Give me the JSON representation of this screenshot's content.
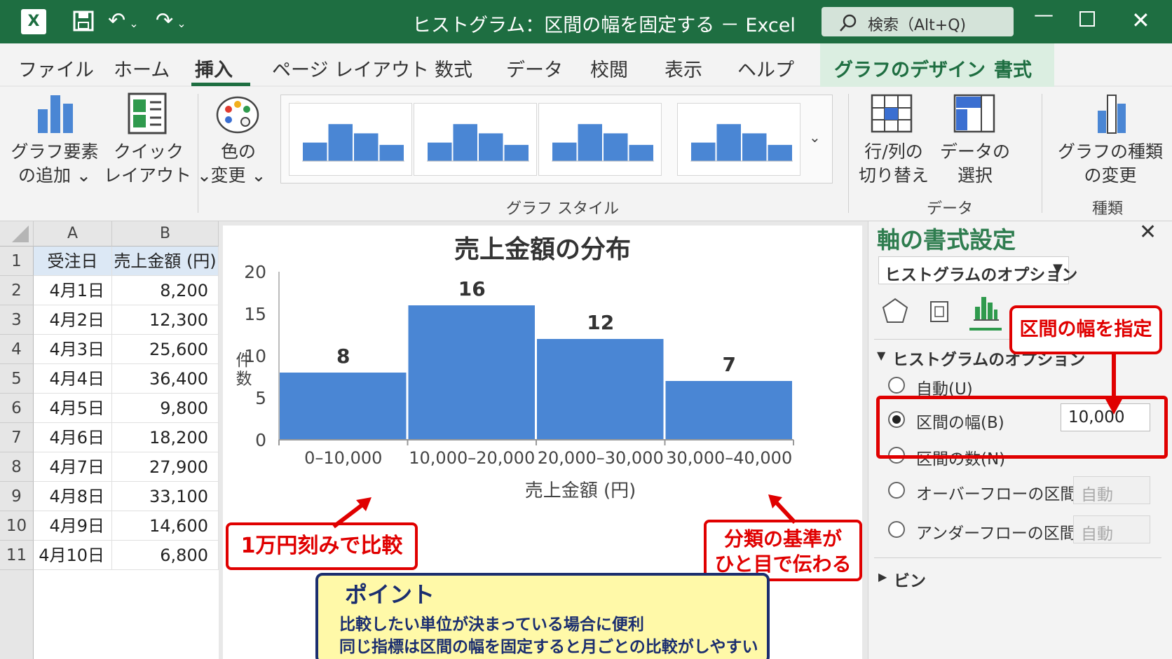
{
  "titlebar": {
    "title": "ヒストグラム：区間の幅を固定する － Excel",
    "search_placeholder": "検索（Alt+Q)"
  },
  "tabs": [
    "ファイル",
    "ホーム",
    "挿入",
    "ページ レイアウト",
    "数式",
    "データ",
    "校閲",
    "表示",
    "ヘルプ"
  ],
  "context_tabs": [
    "グラフのデザイン",
    "書式"
  ],
  "ribbon": {
    "add_element": [
      "グラフ要素",
      "の追加 ⌄"
    ],
    "quick_layout": [
      "クイック",
      "レイアウト ⌄"
    ],
    "colors": [
      "色の",
      "変更 ⌄"
    ],
    "styles_group": "グラフ スタイル",
    "switch_rowcol": [
      "行/列の",
      "切り替え"
    ],
    "select_data": [
      "データの",
      "選択"
    ],
    "data_group": "データ",
    "change_type": [
      "グラフの種類",
      "の変更"
    ],
    "type_group": "種類"
  },
  "sheet": {
    "columns": [
      "A",
      "B"
    ],
    "header": {
      "row": "1",
      "a": "受注日",
      "b": "売上金額 (円)"
    },
    "rows": [
      {
        "n": "2",
        "date": "4月1日",
        "amount": "8,200"
      },
      {
        "n": "3",
        "date": "4月2日",
        "amount": "12,300"
      },
      {
        "n": "4",
        "date": "4月3日",
        "amount": "25,600"
      },
      {
        "n": "5",
        "date": "4月4日",
        "amount": "36,400"
      },
      {
        "n": "6",
        "date": "4月5日",
        "amount": "9,800"
      },
      {
        "n": "7",
        "date": "4月6日",
        "amount": "18,200"
      },
      {
        "n": "8",
        "date": "4月7日",
        "amount": "27,900"
      },
      {
        "n": "9",
        "date": "4月8日",
        "amount": "33,100"
      },
      {
        "n": "10",
        "date": "4月9日",
        "amount": "14,600"
      },
      {
        "n": "11",
        "date": "4月10日",
        "amount": "6,800"
      }
    ]
  },
  "chart_data": {
    "type": "bar",
    "title": "売上金額の分布",
    "xlabel": "売上金額 (円)",
    "ylabel": "件数",
    "categories": [
      "0–10,000",
      "10,000–20,000",
      "20,000–30,000",
      "30,000–40,000"
    ],
    "values": [
      8,
      16,
      12,
      7
    ],
    "ylim": [
      0,
      20
    ],
    "yticks": [
      0,
      5,
      10,
      15,
      20
    ],
    "bar_color": "#4a86d4",
    "data_labels": true
  },
  "pane": {
    "title": "軸の書式設定",
    "dropdown": "ヒストグラムのオプション",
    "section": "ヒストグラムのオプション",
    "auto": "自動(U)",
    "bin_width": "区間の幅(B)",
    "bin_width_value": "10,000",
    "bin_count": "区間の数(N)",
    "overflow": "オーバーフローの区間(O)",
    "underflow": "アンダーフローの区間(E)",
    "auto_placeholder": "自動",
    "bin": "ビン"
  },
  "callouts": {
    "specify_width": "区間の幅を指定",
    "compare": "1万円刻みで比較",
    "criteria": [
      "分類の基準が",
      "ひと目で伝わる"
    ],
    "point_title": "ポイント",
    "point_lines": [
      "比較したい単位が決まっている場合に便利",
      "同じ指標は区間の幅を固定すると月ごとの比較がしやすい"
    ]
  },
  "colors": {
    "excel_green": "#1e6e41",
    "callout_red": "#e00000",
    "point_bg": "#fff9a8",
    "point_border": "#1b2e6f"
  }
}
